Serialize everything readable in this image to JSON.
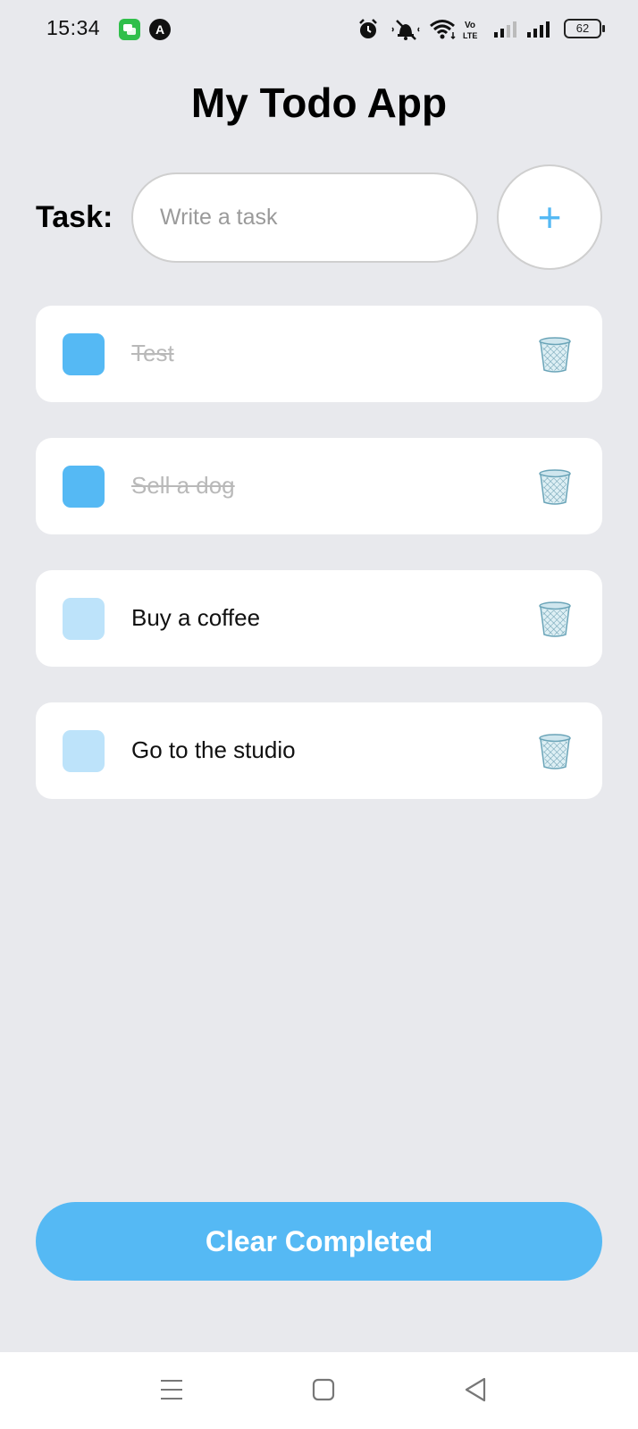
{
  "status_bar": {
    "time": "15:34",
    "battery": "62",
    "icons": [
      "messages-notification-icon",
      "app-notification-icon",
      "alarm-icon",
      "muted-bell-icon",
      "wifi-icon",
      "volte-icon",
      "signal-icon",
      "signal-icon",
      "battery-icon"
    ]
  },
  "header": {
    "title": "My Todo App"
  },
  "input": {
    "label": "Task:",
    "placeholder": "Write a task",
    "value": "",
    "add_label": "+"
  },
  "tasks": [
    {
      "text": "Test",
      "completed": true
    },
    {
      "text": "Sell a dog",
      "completed": true
    },
    {
      "text": "Buy a coffee",
      "completed": false
    },
    {
      "text": "Go to the studio",
      "completed": false
    }
  ],
  "clear_button": {
    "label": "Clear Completed"
  },
  "nav_bar": {
    "icons": [
      "menu-icon",
      "home-icon",
      "back-icon"
    ]
  },
  "colors": {
    "accent": "#55B9F4",
    "checkbox_unchecked": "#BDE3FA",
    "background": "#E8E9ED",
    "card": "#FFFFFF",
    "completed_text": "#B9B9B9"
  }
}
